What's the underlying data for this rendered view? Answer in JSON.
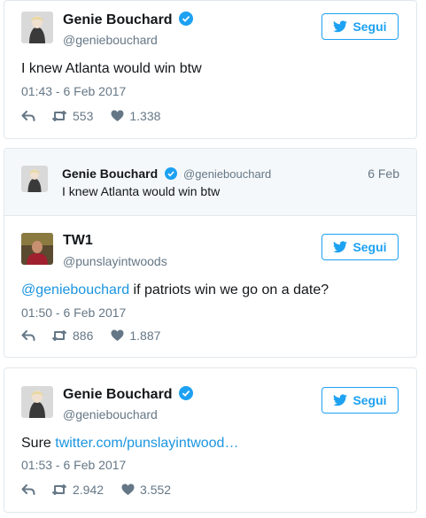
{
  "follow_label": "Segui",
  "colors": {
    "accent": "#1da1f2",
    "link": "#1b95e0",
    "muted": "#657786",
    "text": "#14171a"
  },
  "tweets": [
    {
      "name": "Genie Bouchard",
      "handle": "@geniebouchard",
      "text": "I knew Atlanta would win btw",
      "time": "01:43 - 6 Feb 2017",
      "retweets": "553",
      "likes": "1.338",
      "verified": true
    },
    {
      "quoted": {
        "name": "Genie Bouchard",
        "handle": "@geniebouchard",
        "date": "6 Feb",
        "text": "I knew Atlanta would win btw"
      },
      "name": "TW1",
      "handle": "@punslayintwoods",
      "mention": "@geniebouchard",
      "text": " if patriots win we go on a date?",
      "time": "01:50 - 6 Feb 2017",
      "retweets": "886",
      "likes": "1.887",
      "verified": false
    },
    {
      "name": "Genie Bouchard",
      "handle": "@geniebouchard",
      "text_prefix": "Sure ",
      "link": "twitter.com/punslayintwood…",
      "time": "01:53 - 6 Feb 2017",
      "retweets": "2.942",
      "likes": "3.552",
      "verified": true
    }
  ]
}
